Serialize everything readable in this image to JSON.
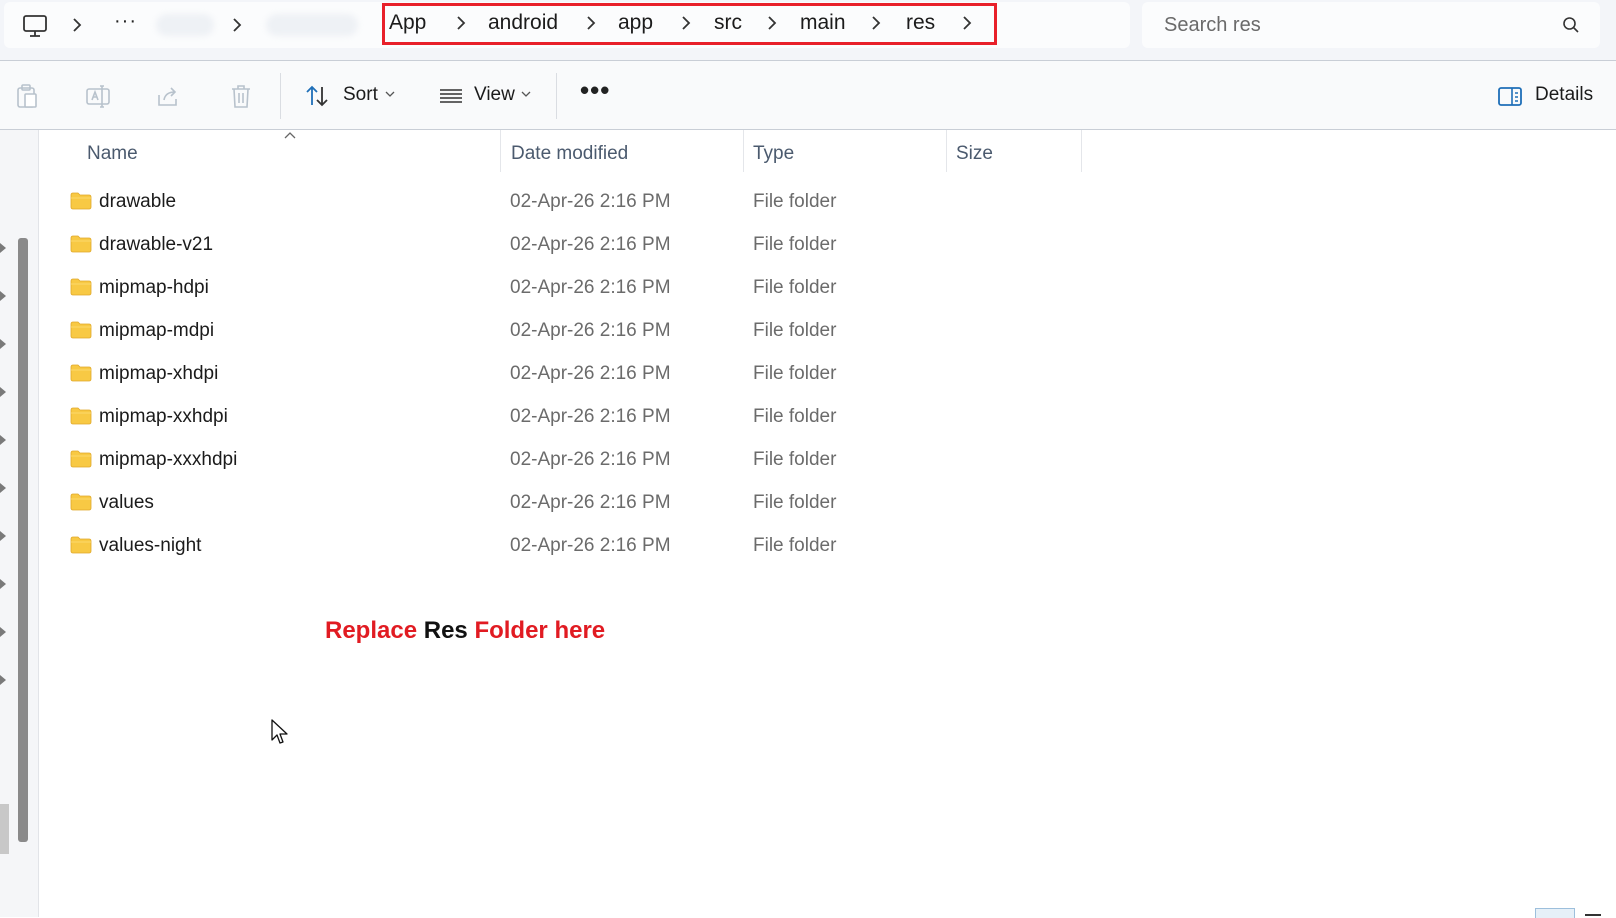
{
  "address_bar": {
    "overflow_label": "···",
    "breadcrumbs": [
      "App",
      "android",
      "app",
      "src",
      "main",
      "res"
    ]
  },
  "search": {
    "placeholder": "Search res"
  },
  "command_bar": {
    "sort_label": "Sort",
    "view_label": "View",
    "more_label": "•••",
    "details_label": "Details"
  },
  "columns": {
    "name": "Name",
    "date": "Date modified",
    "type": "Type",
    "size": "Size"
  },
  "files": [
    {
      "name": "drawable",
      "date": "02-Apr-26 2:16 PM",
      "type": "File folder"
    },
    {
      "name": "drawable-v21",
      "date": "02-Apr-26 2:16 PM",
      "type": "File folder"
    },
    {
      "name": "mipmap-hdpi",
      "date": "02-Apr-26 2:16 PM",
      "type": "File folder"
    },
    {
      "name": "mipmap-mdpi",
      "date": "02-Apr-26 2:16 PM",
      "type": "File folder"
    },
    {
      "name": "mipmap-xhdpi",
      "date": "02-Apr-26 2:16 PM",
      "type": "File folder"
    },
    {
      "name": "mipmap-xxhdpi",
      "date": "02-Apr-26 2:16 PM",
      "type": "File folder"
    },
    {
      "name": "mipmap-xxxhdpi",
      "date": "02-Apr-26 2:16 PM",
      "type": "File folder"
    },
    {
      "name": "values",
      "date": "02-Apr-26 2:16 PM",
      "type": "File folder"
    },
    {
      "name": "values-night",
      "date": "02-Apr-26 2:16 PM",
      "type": "File folder"
    }
  ],
  "annotation": {
    "part1": "Replace",
    "part2": "Res",
    "part3": "Folder here"
  },
  "colors": {
    "highlight_border": "#e8202a",
    "annotation_red": "#e11b22",
    "folder_yellow": "#f8c944"
  },
  "icons": {
    "this_pc": "monitor-icon",
    "search": "search-icon",
    "paste": "clipboard-icon",
    "rename": "rename-icon",
    "share": "share-icon",
    "delete": "trash-icon",
    "sort": "sort-arrows-icon",
    "view": "view-list-icon",
    "details": "details-pane-icon",
    "folder": "folder-icon"
  }
}
